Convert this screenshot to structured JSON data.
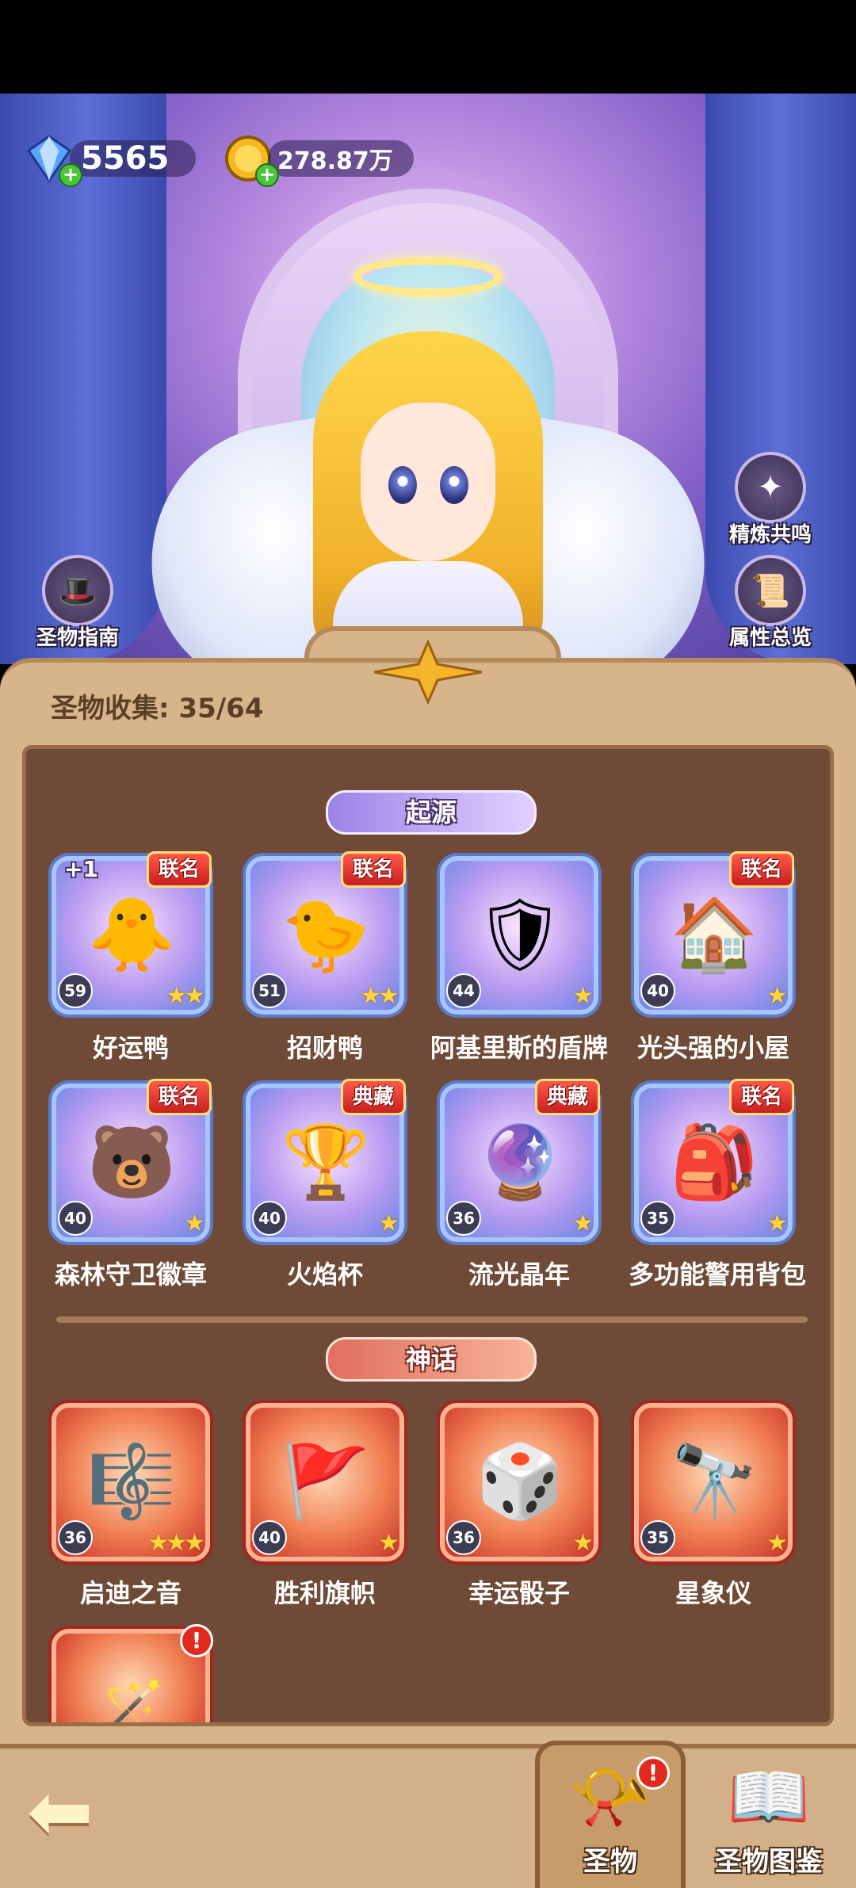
{
  "currencies": {
    "diamond_amount": "5565",
    "coin_amount": "278.87万"
  },
  "side_buttons": {
    "left": {
      "label": "圣物指南"
    },
    "right_top": {
      "label": "精炼共鸣"
    },
    "right_bottom": {
      "label": "属性总览"
    }
  },
  "collection": {
    "label": "圣物收集: 35/64"
  },
  "categories": [
    {
      "label": "起源",
      "items": [
        {
          "name": "好运鸭",
          "level": "59",
          "stars": 2,
          "badge": "联名",
          "bonus": "+1",
          "icon": "duck-icon"
        },
        {
          "name": "招财鸭",
          "level": "51",
          "stars": 2,
          "badge": "联名",
          "bonus": "",
          "icon": "lucky-cat-duck-icon"
        },
        {
          "name": "阿基里斯的盾牌",
          "level": "44",
          "stars": 1,
          "badge": "",
          "bonus": "",
          "icon": "shield-icon"
        },
        {
          "name": "光头强的小屋",
          "level": "40",
          "stars": 1,
          "badge": "联名",
          "bonus": "",
          "icon": "house-icon"
        },
        {
          "name": "森林守卫徽章",
          "level": "40",
          "stars": 1,
          "badge": "联名",
          "bonus": "",
          "icon": "bear-badge-icon"
        },
        {
          "name": "火焰杯",
          "level": "40",
          "stars": 1,
          "badge": "典藏",
          "bonus": "",
          "icon": "goblet-icon"
        },
        {
          "name": "流光晶年",
          "level": "36",
          "stars": 1,
          "badge": "典藏",
          "bonus": "",
          "icon": "crystal-ball-icon"
        },
        {
          "name": "多功能警用背包",
          "level": "35",
          "stars": 1,
          "badge": "联名",
          "bonus": "",
          "icon": "backpack-icon"
        }
      ]
    },
    {
      "label": "神话",
      "items": [
        {
          "name": "启迪之音",
          "level": "36",
          "stars": 3,
          "icon": "harp-icon"
        },
        {
          "name": "胜利旗帜",
          "level": "40",
          "stars": 1,
          "icon": "banner-icon"
        },
        {
          "name": "幸运骰子",
          "level": "36",
          "stars": 1,
          "icon": "dice-icon"
        },
        {
          "name": "星象仪",
          "level": "35",
          "stars": 1,
          "icon": "astrolabe-icon"
        }
      ]
    }
  ],
  "bottom_nav": {
    "back_icon": "arrow-left-icon",
    "tabs": [
      {
        "label": "圣物",
        "active": true
      },
      {
        "label": "圣物图鉴",
        "active": false
      }
    ],
    "alert_mark": "!"
  },
  "colors": {
    "origin_card": "#b99cf0",
    "myth_card": "#f07f52",
    "badge_red": "#c91f1f",
    "panel_brown": "#6e4a37"
  }
}
